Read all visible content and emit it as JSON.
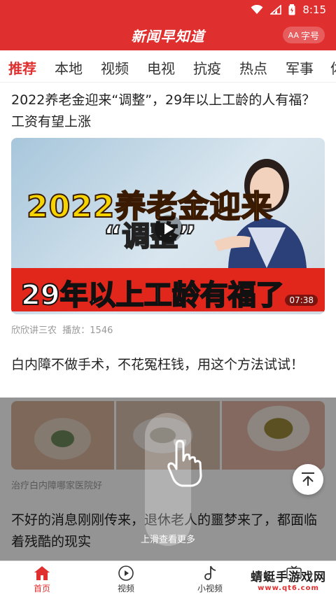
{
  "status_bar": {
    "time": "8:15"
  },
  "header": {
    "title": "新闻早知道",
    "font_size_label": "字号",
    "font_size_prefix": "AA"
  },
  "tabs": [
    {
      "label": "推荐",
      "active": true
    },
    {
      "label": "本地"
    },
    {
      "label": "视频"
    },
    {
      "label": "电视"
    },
    {
      "label": "抗疫"
    },
    {
      "label": "热点"
    },
    {
      "label": "军事"
    },
    {
      "label": "体"
    }
  ],
  "articles": [
    {
      "title": "2022养老金迎来“调整”，29年以上工龄的人有福？工资有望上涨",
      "thumbnail_text": {
        "line1": "2022养老金迎来",
        "line2": "“调整”",
        "banner": "29年以上工龄有福了"
      },
      "duration": "07:38",
      "source": "欣欣讲三农",
      "plays": "播放：1546"
    },
    {
      "title": "白内障不做手术，不花冤枉钱，用这个方法试试！",
      "source": "治疗白内障哪家医院好"
    },
    {
      "title": "不好的消息刚刚传来，退休老人的噩梦来了，都面临着残酷的现实"
    }
  ],
  "overlay": {
    "hint": "上滑查看更多"
  },
  "bottom_nav": [
    {
      "label": "首页",
      "icon": "home-icon",
      "active": true
    },
    {
      "label": "视频",
      "icon": "play-circle-icon"
    },
    {
      "label": "小视频",
      "icon": "music-note-icon"
    },
    {
      "label": "",
      "icon": "tv-icon"
    }
  ],
  "watermark": {
    "main": "蜻蜓手游戏网",
    "sub": "www.qt6.com"
  },
  "colors": {
    "brand_red": "#e02f2f",
    "text": "#222222",
    "meta": "#999999"
  }
}
